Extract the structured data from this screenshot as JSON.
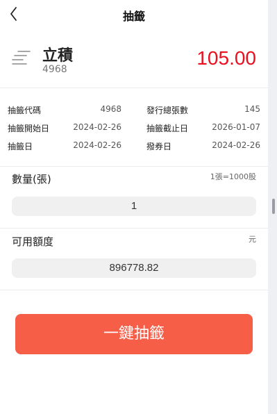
{
  "header": {
    "title": "抽籤",
    "back_icon": "chevron-left-icon"
  },
  "stock": {
    "icon": "list-icon",
    "name": "立積",
    "code": "4968",
    "price": "105.00",
    "price_color": "#e8101f"
  },
  "info": {
    "rows": [
      {
        "label1": "抽籤代碼",
        "value1": "4968",
        "label2": "發行總張數",
        "value2": "145"
      },
      {
        "label1": "抽籤開始日",
        "value1": "2024-02-26",
        "label2": "抽籤截止日",
        "value2": "2026-01-07"
      },
      {
        "label1": "抽籤日",
        "value1": "2024-02-26",
        "label2": "撥券日",
        "value2": "2024-02-26"
      }
    ]
  },
  "quantity": {
    "label": "數量(張)",
    "note": "1張=1000股",
    "value": "1"
  },
  "credit": {
    "label": "可用額度",
    "unit": "元",
    "value": "896778.82"
  },
  "action": {
    "submit_label": "一鍵抽籤",
    "color": "#f75e48"
  }
}
